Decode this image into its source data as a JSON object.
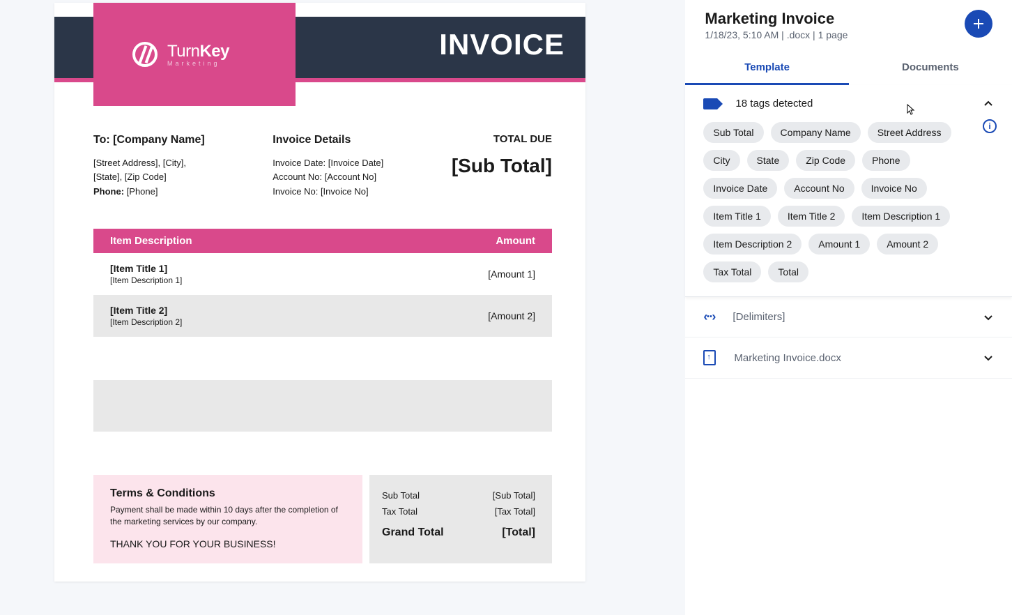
{
  "doc": {
    "invoice_heading": "INVOICE",
    "brand_turn": "Turn",
    "brand_key": "Key",
    "brand_tagline": "Marketing",
    "to_heading": "To: [Company Name]",
    "address_line1": "[Street Address], [City],",
    "address_line2": "[State], [Zip Code]",
    "phone_label": "Phone:",
    "phone_value": " [Phone]",
    "details_heading": "Invoice Details",
    "invoice_date": "Invoice Date: [Invoice Date]",
    "account_no": "Account No: [Account No]",
    "invoice_no": "Invoice No: [Invoice No]",
    "total_due_label": "TOTAL DUE",
    "total_due_value": "[Sub Total]",
    "col_item": "Item Description",
    "col_amount": "Amount",
    "items": [
      {
        "title": "[Item Title 1]",
        "desc": "[Item Description 1]",
        "amount": "[Amount 1]"
      },
      {
        "title": "[Item Title 2]",
        "desc": "[Item Description 2]",
        "amount": "[Amount 2]"
      }
    ],
    "terms_heading": "Terms & Conditions",
    "terms_body": "Payment shall be made within 10 days after the completion of the marketing services by our company.",
    "thanks": "THANK YOU FOR YOUR BUSINESS!",
    "subtotal_label": "Sub Total",
    "subtotal_value": "[Sub Total]",
    "taxtotal_label": "Tax Total",
    "taxtotal_value": "[Tax Total]",
    "grand_label": "Grand Total",
    "grand_value": "[Total]"
  },
  "side": {
    "title": "Marketing Invoice",
    "subtitle": "1/18/23, 5:10 AM | .docx | 1 page",
    "tabs": {
      "template": "Template",
      "documents": "Documents"
    },
    "tags_detected": "18 tags detected",
    "tags": [
      "Sub Total",
      "Company Name",
      "Street Address",
      "City",
      "State",
      "Zip Code",
      "Phone",
      "Invoice Date",
      "Account No",
      "Invoice No",
      "Item Title 1",
      "Item Title 2",
      "Item Description 1",
      "Item Description 2",
      "Amount 1",
      "Amount 2",
      "Tax Total",
      "Total"
    ],
    "delimiters_label": "[Delimiters]",
    "file_label": "Marketing Invoice.docx"
  }
}
